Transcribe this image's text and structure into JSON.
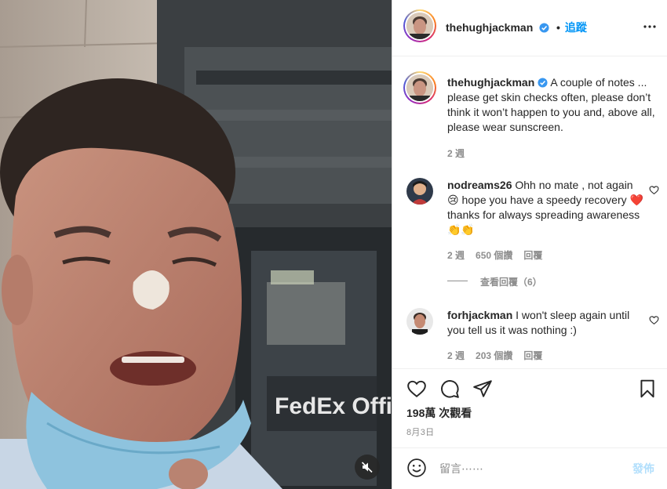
{
  "post": {
    "author": "thehughjackman",
    "follow_sep": "•",
    "follow_label": "追蹤",
    "caption": "A couple of notes ... please get skin checks often, please don’t think it won’t happen to you and, above all, please wear sunscreen.",
    "caption_time": "2 週",
    "media_sign_text": "FedEx Office",
    "views": "198萬 次觀看",
    "date": "8月3日"
  },
  "comments": [
    {
      "user": "nodreams26",
      "text": "Ohh no mate , not again 😢 hope you have a speedy recovery ❤️thanks for always spreading awareness 👏👏",
      "time": "2 週",
      "likes": "650 個讚",
      "reply": "回覆",
      "view_replies": "查看回覆（6）"
    },
    {
      "user": "forhjackman",
      "text": "I won't sleep again until you tell us it was nothing :)",
      "time": "2 週",
      "likes": "203 個讚",
      "reply": "回覆"
    }
  ],
  "composer": {
    "placeholder": "留言⋯⋯",
    "post_label": "發佈"
  },
  "icons": {
    "verified": "verified-badge-icon",
    "more": "more-options-icon",
    "like": "heart-icon",
    "comment": "comment-icon",
    "share": "share-icon",
    "save": "bookmark-icon",
    "emoji": "emoji-icon",
    "mute": "muted-speaker-icon"
  },
  "colors": {
    "link_blue": "#0095f6",
    "verified_blue": "#3897f0",
    "muted_text": "#8e8e8e",
    "post_disabled": "#b2dffc",
    "heart_red": "#ed4956"
  }
}
